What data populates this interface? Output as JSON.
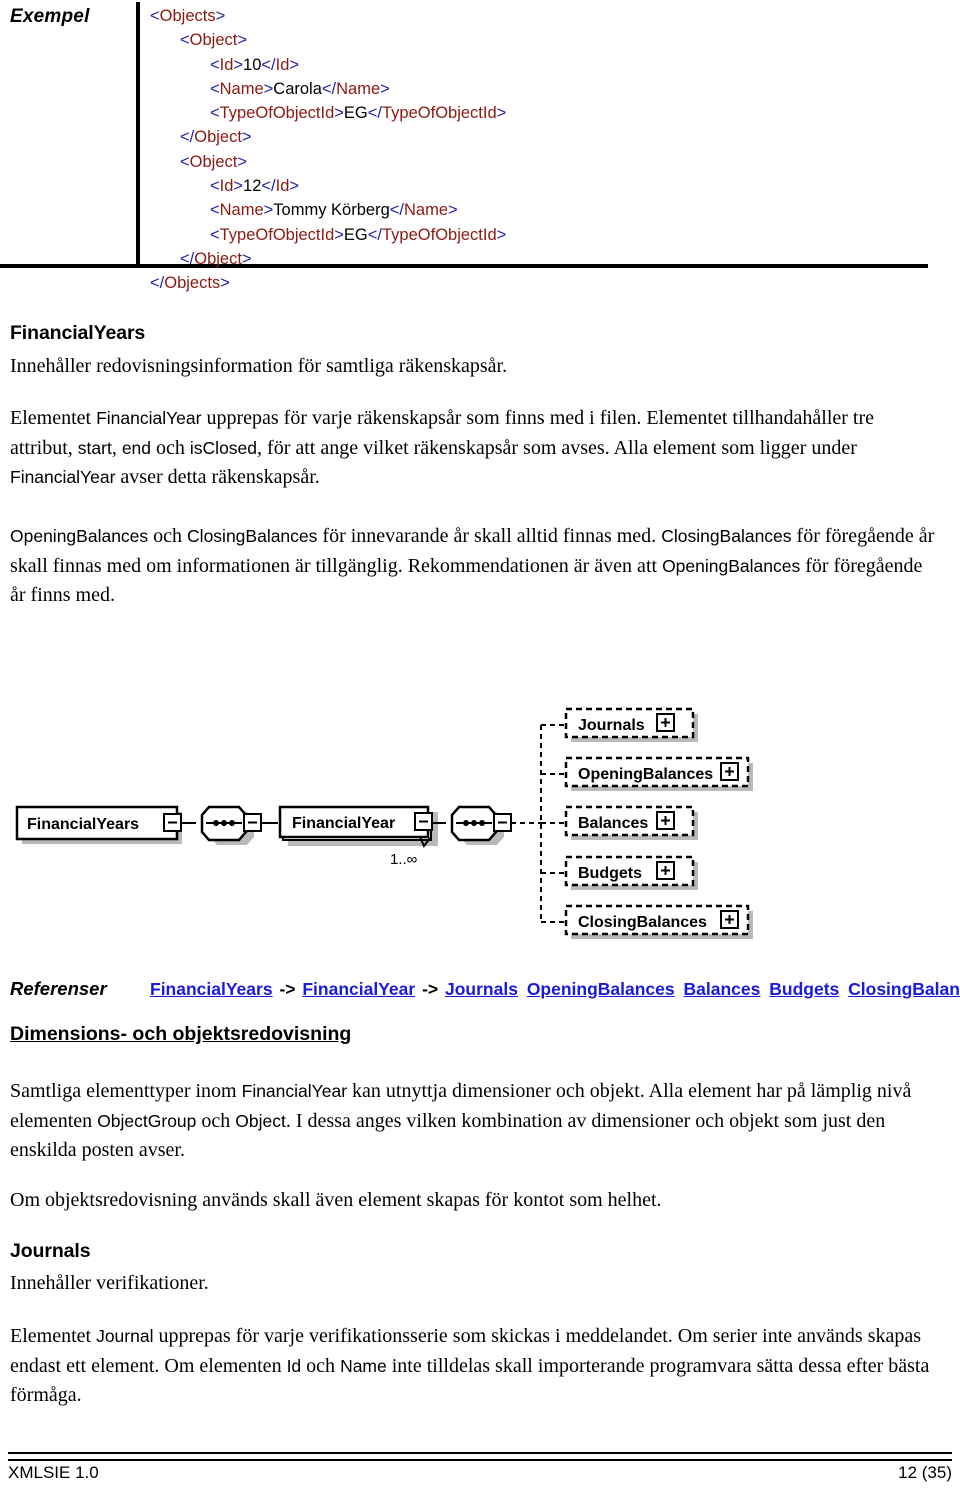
{
  "example": {
    "label": "Exempel",
    "code_lines": [
      {
        "indent": 0,
        "parts": [
          {
            "t": "br",
            "v": "<"
          },
          {
            "t": "tg",
            "v": "Objects"
          },
          {
            "t": "br",
            "v": ">"
          }
        ]
      },
      {
        "indent": 1,
        "parts": [
          {
            "t": "br",
            "v": "<"
          },
          {
            "t": "tg",
            "v": "Object"
          },
          {
            "t": "br",
            "v": ">"
          }
        ]
      },
      {
        "indent": 2,
        "parts": [
          {
            "t": "br",
            "v": "<"
          },
          {
            "t": "tg",
            "v": "Id"
          },
          {
            "t": "br",
            "v": ">"
          },
          {
            "t": "tx",
            "v": "10"
          },
          {
            "t": "br",
            "v": "</"
          },
          {
            "t": "tg",
            "v": "Id"
          },
          {
            "t": "br",
            "v": ">"
          }
        ]
      },
      {
        "indent": 2,
        "parts": [
          {
            "t": "br",
            "v": "<"
          },
          {
            "t": "tg",
            "v": "Name"
          },
          {
            "t": "br",
            "v": ">"
          },
          {
            "t": "tx",
            "v": "Carola"
          },
          {
            "t": "br",
            "v": "</"
          },
          {
            "t": "tg",
            "v": "Name"
          },
          {
            "t": "br",
            "v": ">"
          }
        ]
      },
      {
        "indent": 2,
        "parts": [
          {
            "t": "br",
            "v": "<"
          },
          {
            "t": "tg",
            "v": "TypeOfObjectId"
          },
          {
            "t": "br",
            "v": ">"
          },
          {
            "t": "tx",
            "v": "EG"
          },
          {
            "t": "br",
            "v": "</"
          },
          {
            "t": "tg",
            "v": "TypeOfObjectId"
          },
          {
            "t": "br",
            "v": ">"
          }
        ]
      },
      {
        "indent": 1,
        "parts": [
          {
            "t": "br",
            "v": "</"
          },
          {
            "t": "tg",
            "v": "Object"
          },
          {
            "t": "br",
            "v": ">"
          }
        ]
      },
      {
        "indent": 1,
        "parts": [
          {
            "t": "br",
            "v": "<"
          },
          {
            "t": "tg",
            "v": "Object"
          },
          {
            "t": "br",
            "v": ">"
          }
        ]
      },
      {
        "indent": 2,
        "parts": [
          {
            "t": "br",
            "v": "<"
          },
          {
            "t": "tg",
            "v": "Id"
          },
          {
            "t": "br",
            "v": ">"
          },
          {
            "t": "tx",
            "v": "12"
          },
          {
            "t": "br",
            "v": "</"
          },
          {
            "t": "tg",
            "v": "Id"
          },
          {
            "t": "br",
            "v": ">"
          }
        ]
      },
      {
        "indent": 2,
        "parts": [
          {
            "t": "br",
            "v": "<"
          },
          {
            "t": "tg",
            "v": "Name"
          },
          {
            "t": "br",
            "v": ">"
          },
          {
            "t": "tx",
            "v": "Tommy Körberg"
          },
          {
            "t": "br",
            "v": "</"
          },
          {
            "t": "tg",
            "v": "Name"
          },
          {
            "t": "br",
            "v": ">"
          }
        ]
      },
      {
        "indent": 2,
        "parts": [
          {
            "t": "br",
            "v": "<"
          },
          {
            "t": "tg",
            "v": "TypeOfObjectId"
          },
          {
            "t": "br",
            "v": ">"
          },
          {
            "t": "tx",
            "v": "EG"
          },
          {
            "t": "br",
            "v": "</"
          },
          {
            "t": "tg",
            "v": "TypeOfObjectId"
          },
          {
            "t": "br",
            "v": ">"
          }
        ]
      },
      {
        "indent": 1,
        "parts": [
          {
            "t": "br",
            "v": "</"
          },
          {
            "t": "tg",
            "v": "Object"
          },
          {
            "t": "br",
            "v": ">"
          }
        ]
      },
      {
        "indent": 0,
        "parts": [
          {
            "t": "br",
            "v": "</"
          },
          {
            "t": "tg",
            "v": "Objects"
          },
          {
            "t": "br",
            "v": ">"
          }
        ]
      }
    ]
  },
  "financialyears": {
    "heading": "FinancialYears",
    "intro": "Innehåller redovisningsinformation för samtliga räkenskapsår.",
    "para1_a": "Elementet ",
    "para1_code1": "FinancialYear",
    "para1_b": " upprepas för varje räkenskapsår som finns med i filen. Elementet tillhandahåller tre attribut, ",
    "para1_code2": "start",
    "para1_c": ", ",
    "para1_code3": "end",
    "para1_d": " och ",
    "para1_code4": "isClosed",
    "para1_e": ", för att ange vilket räkenskapsår som avses. Alla element som ligger under ",
    "para1_code5": "FinancialYear",
    "para1_f": " avser detta räkenskapsår.",
    "para2_code1": "OpeningBalances",
    "para2_a": " och ",
    "para2_code2": "ClosingBalances",
    "para2_b": " för innevarande år skall alltid finnas med. ",
    "para2_code3": "ClosingBalances",
    "para2_c": " för föregående år skall finnas med om informationen är tillgänglig. Rekommendationen är även att ",
    "para2_code4": "OpeningBalances",
    "para2_d": " för föregående år finns med."
  },
  "diagram": {
    "root": "FinancialYears",
    "child": "FinancialYear",
    "multiplicity": "1..∞",
    "leaves": [
      {
        "label": "Journals"
      },
      {
        "label": "OpeningBalances"
      },
      {
        "label": "Balances"
      },
      {
        "label": "Budgets"
      },
      {
        "label": "ClosingBalances"
      }
    ],
    "expand_glyph": "+"
  },
  "references": {
    "label": "Referenser",
    "items": [
      "FinancialYears",
      "FinancialYear",
      "Journals",
      "OpeningBalances",
      "Balances",
      "Budgets",
      "ClosingBalances"
    ],
    "arrow": "->"
  },
  "dimensions": {
    "heading": "Dimensions- och objektsredovisning",
    "para1_a": "Samtliga elementtyper inom ",
    "para1_code1": "FinancialYear",
    "para1_b": " kan utnyttja dimensioner och objekt. Alla element har på lämplig nivå elementen ",
    "para1_code2": "ObjectGroup",
    "para1_c": " och ",
    "para1_code3": "Object",
    "para1_d": ". I dessa anges vilken kombination av dimensioner och objekt som just den enskilda posten avser.",
    "para2": "Om objektsredovisning används skall även element skapas för kontot som helhet."
  },
  "journals": {
    "heading": "Journals",
    "intro": "Innehåller verifikationer.",
    "para_a": "Elementet ",
    "para_code1": "Journal",
    "para_b": " upprepas för varje verifikationsserie som skickas i meddelandet. Om serier inte används skapas endast ett element. Om elementen ",
    "para_code2": "Id",
    "para_c": " och ",
    "para_code3": "Name",
    "para_d": " inte tilldelas skall importerande programvara sätta dessa efter bästa förmåga."
  },
  "footer": {
    "left": "XMLSIE 1.0",
    "right": "12 (35)"
  },
  "colors": {
    "bracket": "#1f1fae",
    "tag": "#8b1a11",
    "link": "#1a1ae0",
    "shadow": "#b9b9b9"
  }
}
